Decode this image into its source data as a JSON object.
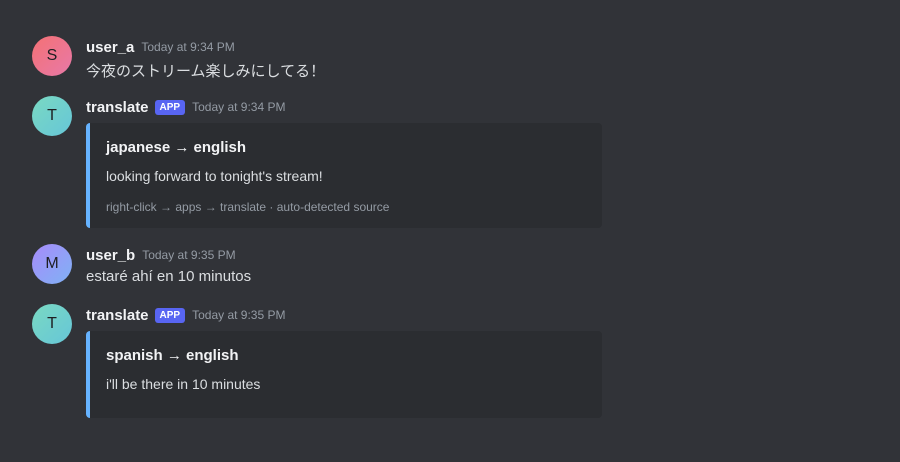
{
  "messages": [
    {
      "avatar_letter": "S",
      "username": "user_a",
      "timestamp": "Today at 9:34 PM",
      "content": "今夜のストリーム楽しみにしてる！"
    },
    {
      "avatar_letter": "T",
      "username": "translate",
      "badge": "APP",
      "timestamp": "Today at 9:34 PM",
      "embed": {
        "title": "japanese → english",
        "description": "looking forward to tonight's stream!",
        "footer": "right-click → apps → translate · auto-detected source"
      }
    },
    {
      "avatar_letter": "M",
      "username": "user_b",
      "timestamp": "Today at 9:35 PM",
      "content": "estaré ahí en 10 minutos"
    },
    {
      "avatar_letter": "T",
      "username": "translate",
      "badge": "APP",
      "timestamp": "Today at 9:35 PM",
      "embed": {
        "title": "spanish → english",
        "description": "i'll be there in 10 minutes"
      }
    }
  ],
  "colors": {
    "background": "#313338",
    "embed_background": "#2b2d31",
    "embed_accent": "#66b3ff",
    "app_badge": "#5865f2"
  }
}
